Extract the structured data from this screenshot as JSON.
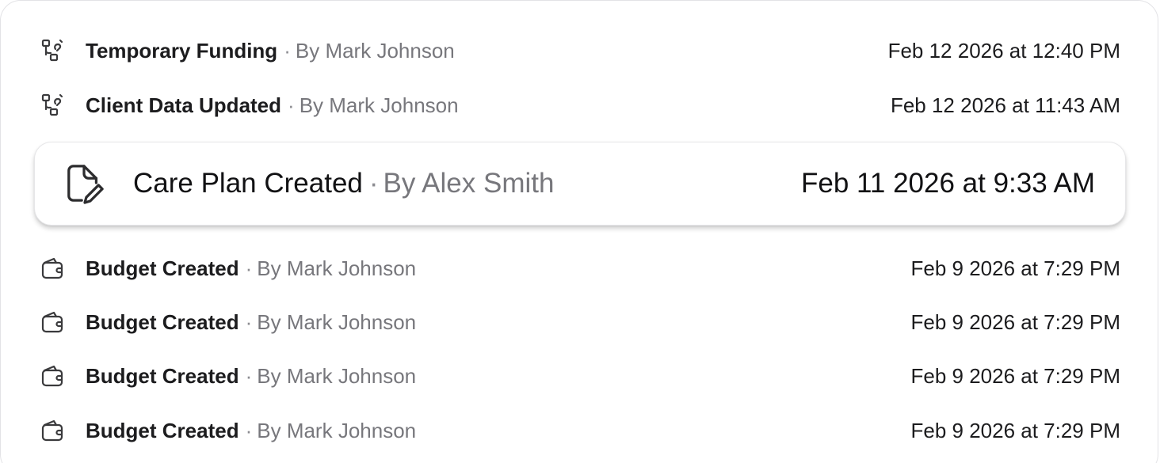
{
  "activity": {
    "items": [
      {
        "icon": "workflow-icon",
        "title": "Temporary Funding",
        "separator": "·",
        "author": "By Mark Johnson",
        "date": "Feb 12 2026 at 12:40 PM"
      },
      {
        "icon": "workflow-icon",
        "title": "Client Data Updated",
        "separator": "·",
        "author": "By Mark Johnson",
        "date": "Feb 12 2026 at 11:43 AM"
      },
      {
        "icon": "document-edit-icon",
        "title": "Care Plan Created",
        "separator": "·",
        "author": "By Alex Smith",
        "date": "Feb 11 2026 at 9:33 AM",
        "highlighted": true
      },
      {
        "icon": "wallet-icon",
        "title": "Budget Created",
        "separator": "·",
        "author": "By Mark Johnson",
        "date": "Feb 9 2026 at 7:29 PM"
      },
      {
        "icon": "wallet-icon",
        "title": "Budget Created",
        "separator": "·",
        "author": "By Mark Johnson",
        "date": "Feb 9 2026 at 7:29 PM"
      },
      {
        "icon": "wallet-icon",
        "title": "Budget Created",
        "separator": "·",
        "author": "By Mark Johnson",
        "date": "Feb 9 2026 at 7:29 PM"
      },
      {
        "icon": "wallet-icon",
        "title": "Budget Created",
        "separator": "·",
        "author": "By Mark Johnson",
        "date": "Feb 9 2026 at 7:29 PM"
      }
    ]
  },
  "colors": {
    "text_primary": "#1c1c1e",
    "text_secondary": "#77777c",
    "border": "#e3e3e6"
  }
}
